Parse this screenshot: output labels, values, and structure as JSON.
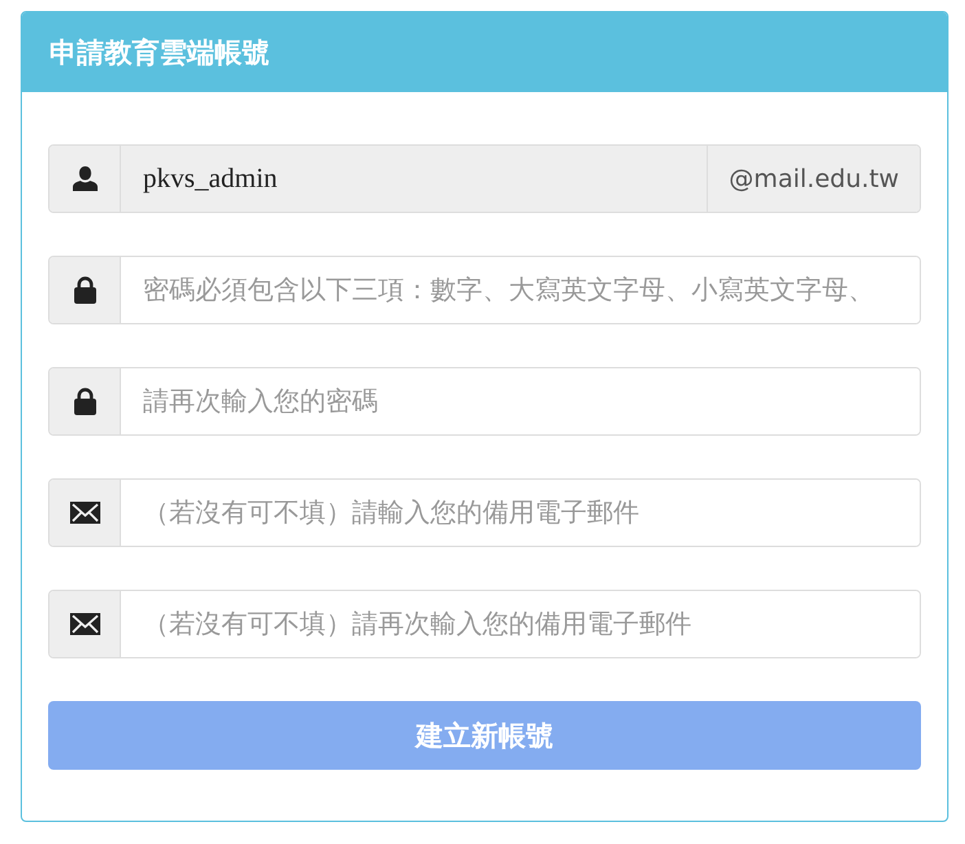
{
  "panel": {
    "title": "申請教育雲端帳號"
  },
  "fields": [
    {
      "kind": "user",
      "value": "pkvs_admin",
      "suffix": "@mail.edu.tw",
      "disabled": true
    },
    {
      "kind": "password",
      "placeholder": "密碼必須包含以下三項：數字、大寫英文字母、小寫英文字母、",
      "disabled": false
    },
    {
      "kind": "password",
      "placeholder": "請再次輸入您的密碼",
      "disabled": false
    },
    {
      "kind": "email",
      "placeholder": "（若沒有可不填）請輸入您的備用電子郵件",
      "disabled": false
    },
    {
      "kind": "email",
      "placeholder": "（若沒有可不填）請再次輸入您的備用電子郵件",
      "disabled": false
    }
  ],
  "submit": {
    "label": "建立新帳號"
  }
}
